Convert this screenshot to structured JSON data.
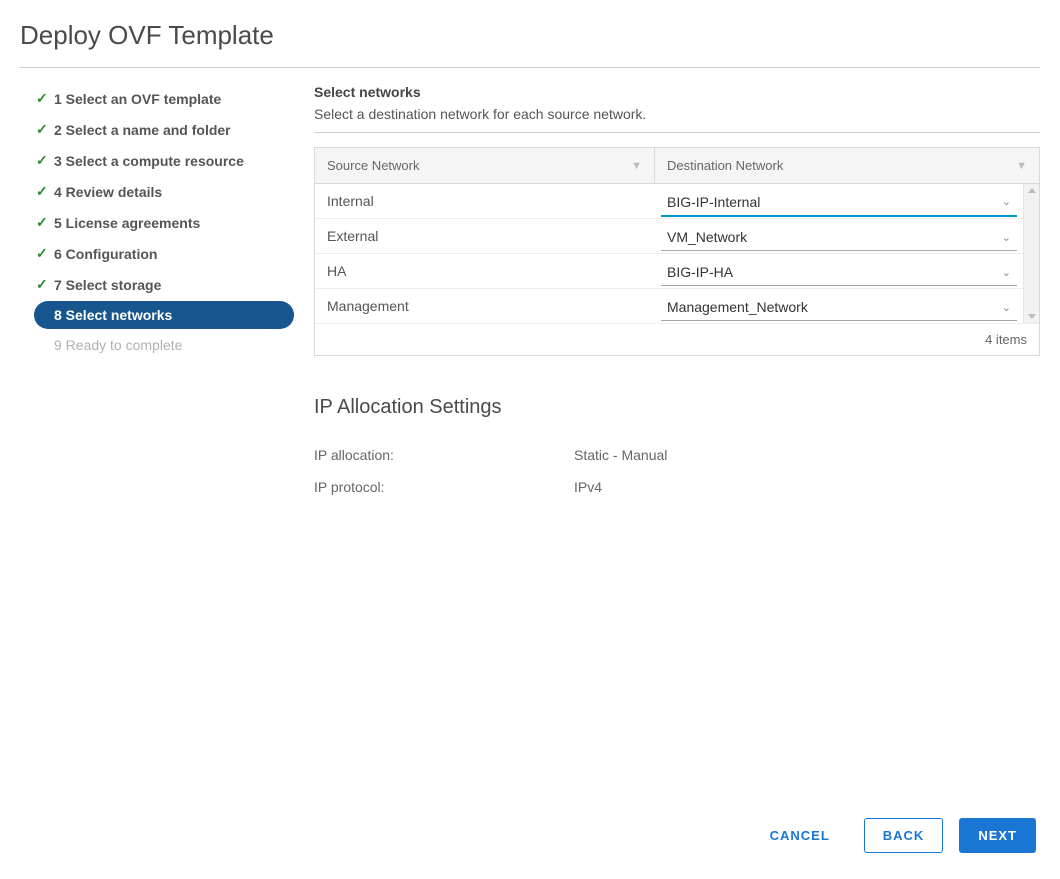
{
  "title": "Deploy OVF Template",
  "steps": [
    {
      "label": "1 Select an OVF template",
      "state": "done"
    },
    {
      "label": "2 Select a name and folder",
      "state": "done"
    },
    {
      "label": "3 Select a compute resource",
      "state": "done"
    },
    {
      "label": "4 Review details",
      "state": "done"
    },
    {
      "label": "5 License agreements",
      "state": "done"
    },
    {
      "label": "6 Configuration",
      "state": "done"
    },
    {
      "label": "7 Select storage",
      "state": "done"
    },
    {
      "label": "8 Select networks",
      "state": "active"
    },
    {
      "label": "9 Ready to complete",
      "state": "pending"
    }
  ],
  "section": {
    "heading": "Select networks",
    "description": "Select a destination network for each source network."
  },
  "table": {
    "headers": {
      "source": "Source Network",
      "destination": "Destination Network"
    },
    "rows": [
      {
        "source": "Internal",
        "destination": "BIG-IP-Internal",
        "active": true
      },
      {
        "source": "External",
        "destination": "VM_Network",
        "active": false
      },
      {
        "source": "HA",
        "destination": "BIG-IP-HA",
        "active": false
      },
      {
        "source": "Management",
        "destination": "Management_Network",
        "active": false
      }
    ],
    "footer": "4 items"
  },
  "ip_settings": {
    "heading": "IP Allocation Settings",
    "alloc_label": "IP allocation:",
    "alloc_value": "Static - Manual",
    "proto_label": "IP protocol:",
    "proto_value": "IPv4"
  },
  "buttons": {
    "cancel": "CANCEL",
    "back": "BACK",
    "next": "NEXT"
  }
}
